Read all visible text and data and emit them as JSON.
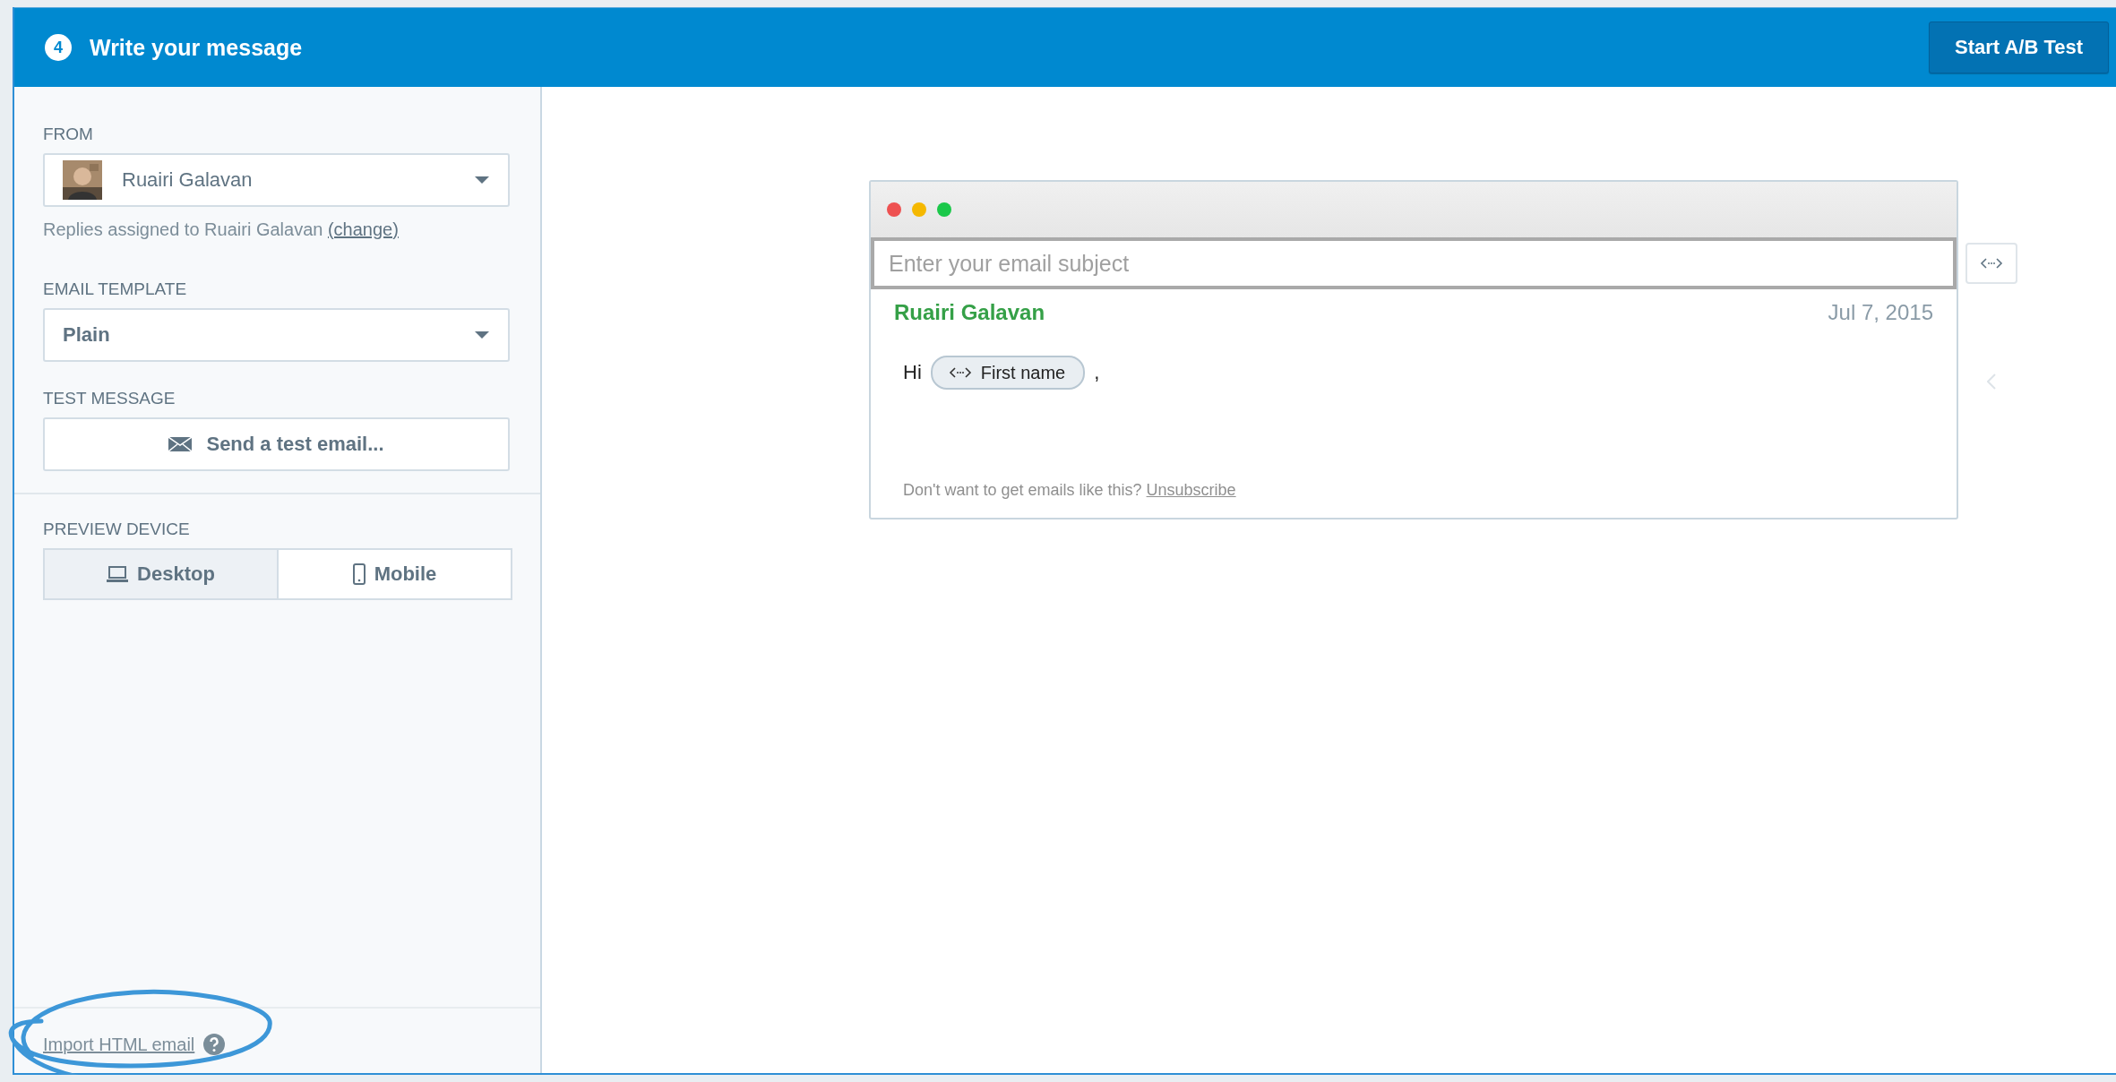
{
  "header": {
    "step": "4",
    "title": "Write your message",
    "action_button": "Start A/B Test"
  },
  "sidebar": {
    "from": {
      "label": "FROM",
      "value": "Ruairi Galavan",
      "note": "Replies assigned to Ruairi Galavan",
      "note_link": "(change)"
    },
    "template": {
      "label": "EMAIL TEMPLATE",
      "value": "Plain"
    },
    "test": {
      "label": "TEST MESSAGE",
      "button": "Send a test email..."
    },
    "preview_device": {
      "label": "PREVIEW DEVICE",
      "options": [
        {
          "label": "Desktop",
          "kind": "desktop",
          "selected": true
        },
        {
          "label": "Mobile",
          "kind": "mobile",
          "selected": false
        }
      ]
    },
    "import_link": "Import HTML email"
  },
  "preview": {
    "subject": {
      "placeholder": "Enter your email subject"
    },
    "sender": "Ruairi Galavan",
    "date": "Jul 7, 2015",
    "greeting": "Hi",
    "merge_tag": "First name",
    "after_tag": ",",
    "footer": "Don't want to get emails like this?",
    "footer_link": "Unsubscribe"
  }
}
